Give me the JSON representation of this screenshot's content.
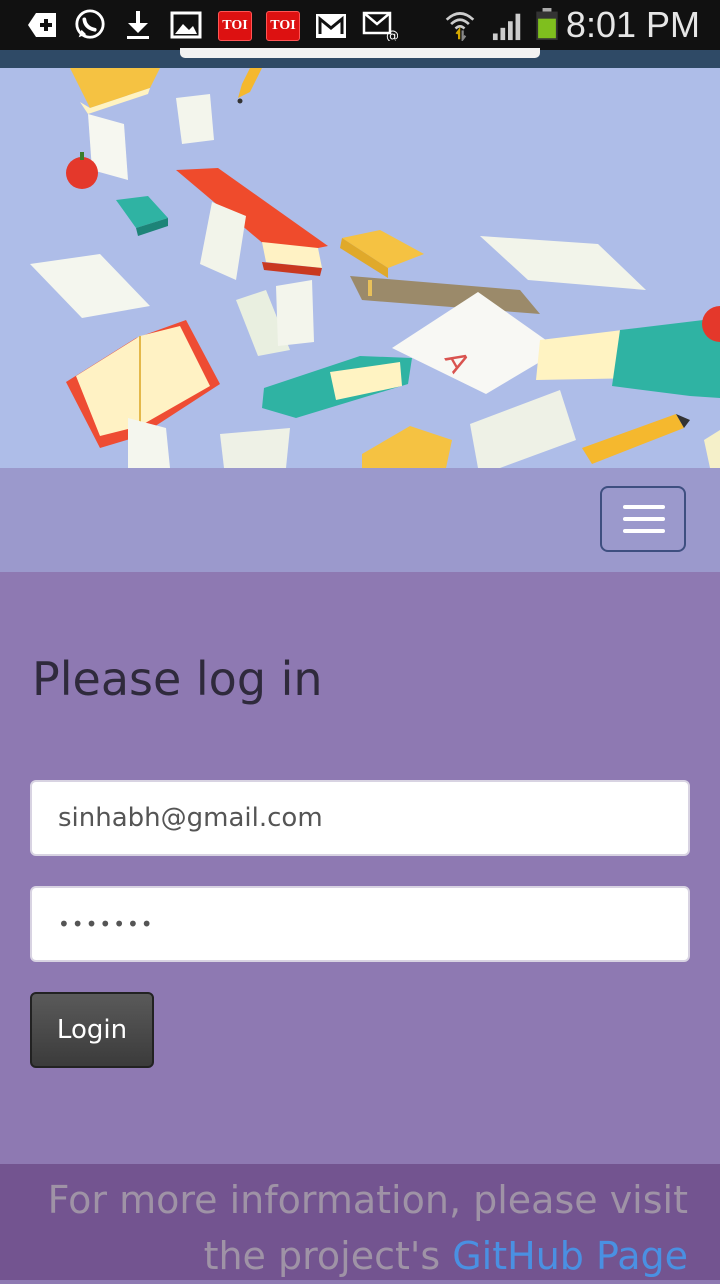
{
  "status_bar": {
    "time": "8:01 PM",
    "notification_icons": [
      "add-icon",
      "whatsapp-icon",
      "download-icon",
      "gallery-icon",
      "toi-icon",
      "toi-icon",
      "gmail-icon",
      "email-icon"
    ],
    "toi_label": "TOI",
    "status_icons": [
      "wifi-icon",
      "signal-icon",
      "battery-icon"
    ]
  },
  "hero": {
    "illustration": "flying-books-illustration"
  },
  "navbar": {
    "toggle_icon": "hamburger-menu-icon"
  },
  "main": {
    "title": "Please log in",
    "email_value": "sinhabh@gmail.com",
    "password_value": "•••••••",
    "login_label": "Login"
  },
  "footer": {
    "text_before": "For more information, please visit the project's ",
    "link_text": "GitHub Page"
  },
  "colors": {
    "hero_bg": "#aebde8",
    "navbar_bg": "#9b99cc",
    "main_bg": "#8e79b2",
    "footer_bg": "#735490",
    "link": "#4a90e2"
  }
}
